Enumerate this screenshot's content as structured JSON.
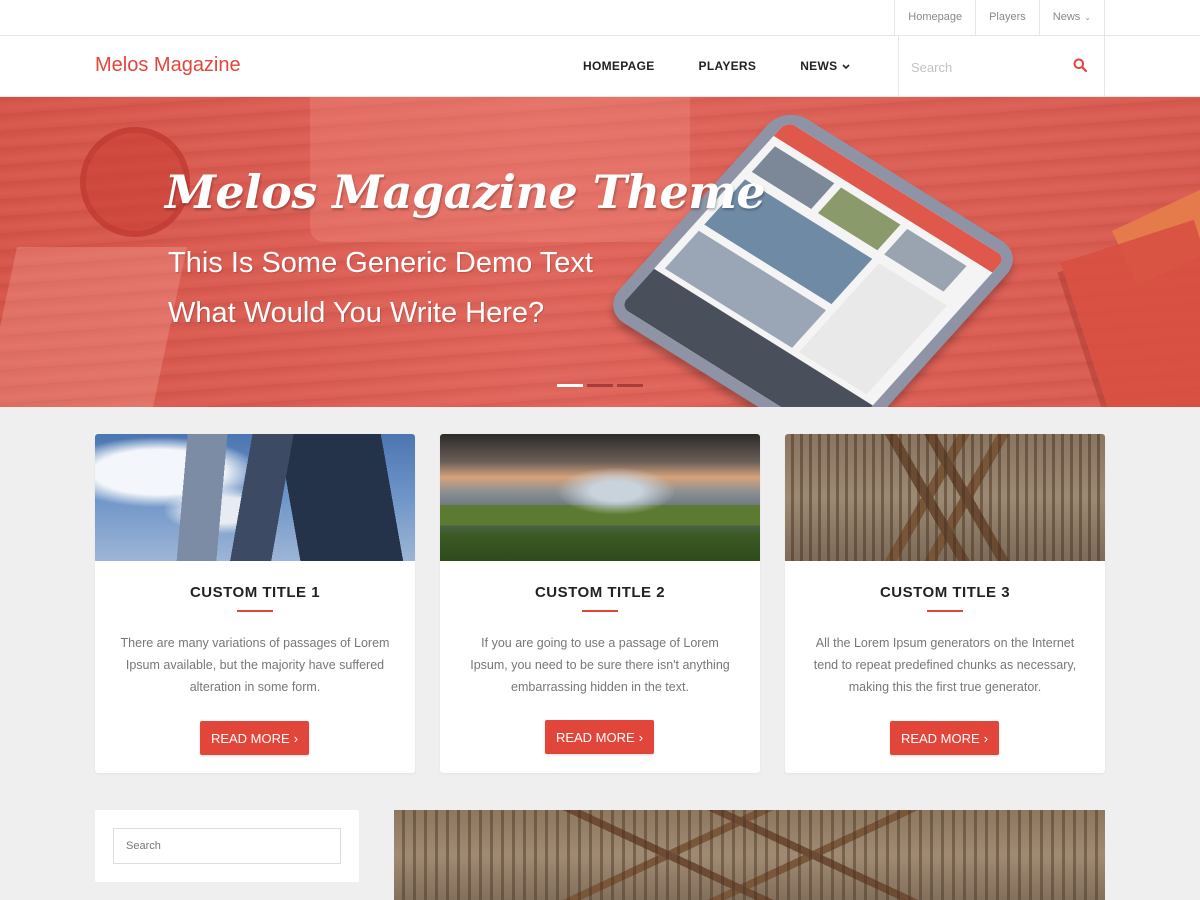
{
  "topbar": {
    "links": [
      {
        "label": "Homepage"
      },
      {
        "label": "Players"
      },
      {
        "label": "News"
      }
    ]
  },
  "header": {
    "logo": "Melos Magazine",
    "nav": [
      {
        "label": "HOMEPAGE"
      },
      {
        "label": "PLAYERS"
      },
      {
        "label": "NEWS"
      }
    ],
    "search_placeholder": "Search"
  },
  "hero": {
    "title": "Melos Magazine Theme",
    "line1": "This Is Some Generic Demo Text",
    "line2": "What Would You Write Here?",
    "slides_count": 3,
    "active_slide": 1
  },
  "cards": [
    {
      "title": "CUSTOM TITLE 1",
      "text": "There are many variations of passages of Lorem Ipsum available, but the majority have suffered alteration in some form.",
      "button": "READ MORE"
    },
    {
      "title": "CUSTOM TITLE 2",
      "text": "If you are going to use a passage of Lorem Ipsum, you need to be sure there isn't anything embarrassing hidden in the text.",
      "button": "READ MORE"
    },
    {
      "title": "CUSTOM TITLE 3",
      "text": "All the Lorem Ipsum generators on the Internet tend to repeat predefined chunks as necessary, making this the first true generator.",
      "button": "READ MORE"
    }
  ],
  "sidebar": {
    "search_placeholder": "Search"
  },
  "colors": {
    "accent": "#e2463a",
    "background": "#efefef"
  }
}
